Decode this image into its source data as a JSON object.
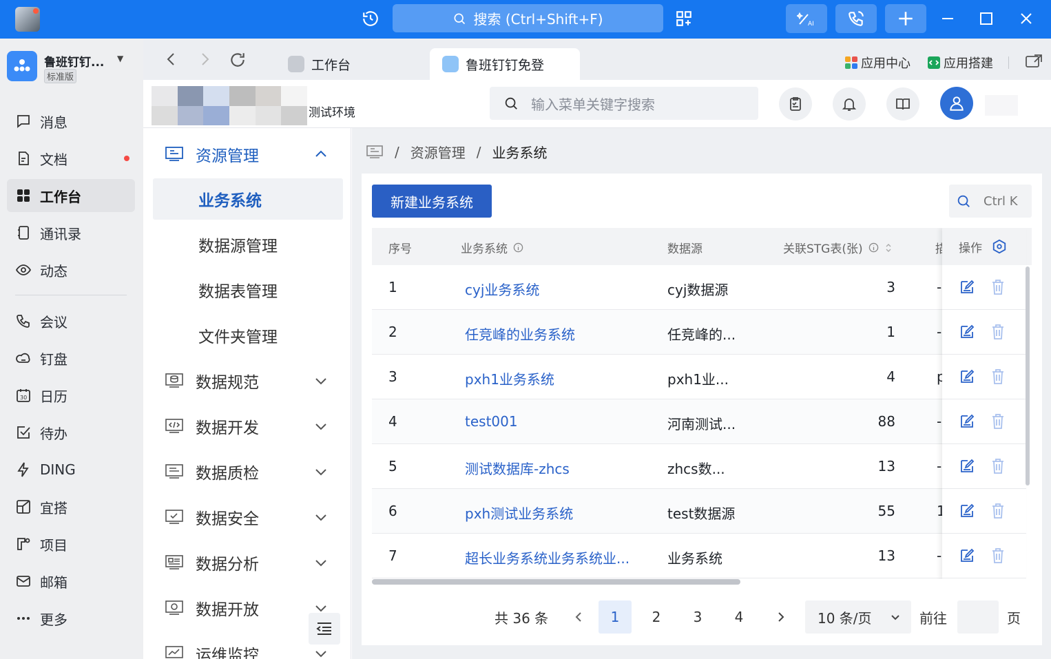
{
  "titlebar": {
    "search_placeholder": "搜索 (Ctrl+Shift+F)"
  },
  "org": {
    "name": "鲁班钉钉...",
    "edition": "标准版"
  },
  "nav": [
    {
      "label": "消息",
      "icon": "message-icon"
    },
    {
      "label": "文档",
      "icon": "document-icon",
      "dot": true
    },
    {
      "label": "工作台",
      "icon": "workbench-icon",
      "active": true
    },
    {
      "label": "通讯录",
      "icon": "contacts-icon"
    },
    {
      "label": "动态",
      "icon": "eye-icon"
    },
    {
      "label": "会议",
      "icon": "meeting-icon"
    },
    {
      "label": "钉盘",
      "icon": "cloud-icon"
    },
    {
      "label": "日历",
      "icon": "calendar-icon"
    },
    {
      "label": "待办",
      "icon": "todo-icon"
    },
    {
      "label": "DING",
      "icon": "lightning-icon"
    },
    {
      "label": "宜搭",
      "icon": "yida-icon"
    },
    {
      "label": "项目",
      "icon": "project-icon"
    },
    {
      "label": "邮箱",
      "icon": "mail-icon"
    },
    {
      "label": "更多",
      "icon": "more-icon"
    }
  ],
  "tabs": [
    {
      "label": "工作台"
    },
    {
      "label": "鲁班钉钉免登"
    }
  ],
  "topright": {
    "app_center": "应用中心",
    "app_build": "应用搭建"
  },
  "apphead": {
    "env": "测试环境",
    "menu_search_placeholder": "输入菜单关键字搜索"
  },
  "sidemenu": {
    "group_open": "资源管理",
    "subitems": [
      "业务系统",
      "数据源管理",
      "数据表管理",
      "文件夹管理"
    ],
    "groups": [
      "数据规范",
      "数据开发",
      "数据质检",
      "数据安全",
      "数据分析",
      "数据开放",
      "运维监控"
    ]
  },
  "breadcrumb": {
    "level1": "资源管理",
    "level2": "业务系统",
    "sep": "/"
  },
  "toolbar": {
    "new_button": "新建业务系统",
    "shortcut": "Ctrl K"
  },
  "table": {
    "headers": {
      "index": "序号",
      "system": "业务系统",
      "datasource": "数据源",
      "stg": "关联STG表(张)",
      "op": "操作"
    },
    "rows": [
      {
        "index": "1",
        "system": "cyj业务系统",
        "datasource": "cyj数据源",
        "stg": "3",
        "extra": "-"
      },
      {
        "index": "2",
        "system": "任竞峰的业务系统",
        "datasource": "任竞峰的...",
        "stg": "1",
        "extra": "-"
      },
      {
        "index": "3",
        "system": "pxh1业务系统",
        "datasource": "pxh1业...",
        "stg": "4",
        "extra": "p"
      },
      {
        "index": "4",
        "system": "test001",
        "datasource": "河南测试...",
        "stg": "88",
        "extra": "-"
      },
      {
        "index": "5",
        "system": "测试数据库-zhcs",
        "datasource": "zhcs数...",
        "stg": "13",
        "extra": "-"
      },
      {
        "index": "6",
        "system": "pxh测试业务系统",
        "datasource": "test数据源",
        "stg": "55",
        "extra": "1"
      },
      {
        "index": "7",
        "system": "超长业务系统业务系统业...",
        "datasource": "业务系统",
        "stg": "13",
        "extra": "-"
      }
    ]
  },
  "pager": {
    "total": "共 36 条",
    "pages": [
      "1",
      "2",
      "3",
      "4"
    ],
    "page_size": "10 条/页",
    "goto": "前往",
    "page_unit": "页"
  },
  "colors": {
    "titlebar": "#1677f0",
    "primary": "#2a5fc4",
    "link": "#2a62c9"
  }
}
